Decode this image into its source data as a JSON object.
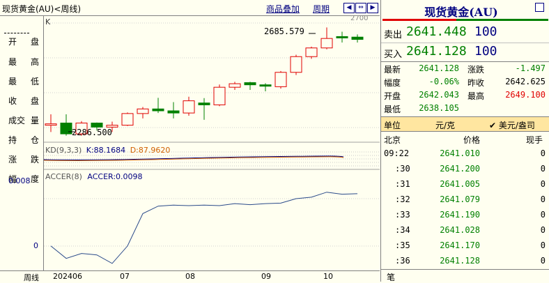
{
  "header": {
    "title": "现货黄金(AU)<周线)",
    "link_overlay": "商品叠加",
    "link_period": "周期"
  },
  "left_labels": [
    {
      "a": "开",
      "b": "盘"
    },
    {
      "a": "最",
      "b": "高"
    },
    {
      "a": "最",
      "b": "低"
    },
    {
      "a": "收",
      "b": "盘"
    },
    {
      "a": "成交",
      "b": "量"
    },
    {
      "a": "持",
      "b": "仓"
    },
    {
      "a": "涨",
      "b": "跌"
    },
    {
      "a": "幅",
      "b": "度"
    }
  ],
  "chart": {
    "k_label": "K",
    "top_axis_label": "2700",
    "high_annotation": "2685.579",
    "low_annotation": "2286.500",
    "kd_label": "KD(9,3,3)",
    "kd_k": "K:88.1684",
    "kd_d": "D:87.9620",
    "accer_label": "ACCER(8)",
    "accer_value": "ACCER:0.0098",
    "accer_tick_high": "0.008",
    "accer_tick_zero": "0",
    "x_labels": [
      "202406",
      "07",
      "08",
      "09",
      "10"
    ],
    "period_label": "周线"
  },
  "chart_data": {
    "type": "candlestick",
    "candles": [
      {
        "o": 2330,
        "h": 2365,
        "l": 2300,
        "c": 2330
      },
      {
        "o": 2333,
        "h": 2365,
        "l": 2286.5,
        "c": 2293
      },
      {
        "o": 2293,
        "h": 2340,
        "l": 2286.5,
        "c": 2333
      },
      {
        "o": 2333,
        "h": 2335,
        "l": 2305,
        "c": 2318
      },
      {
        "o": 2318,
        "h": 2338,
        "l": 2300,
        "c": 2325
      },
      {
        "o": 2325,
        "h": 2372,
        "l": 2322,
        "c": 2368
      },
      {
        "o": 2368,
        "h": 2392,
        "l": 2350,
        "c": 2385
      },
      {
        "o": 2385,
        "h": 2426,
        "l": 2370,
        "c": 2378
      },
      {
        "o": 2378,
        "h": 2410,
        "l": 2350,
        "c": 2370
      },
      {
        "o": 2370,
        "h": 2430,
        "l": 2360,
        "c": 2415
      },
      {
        "o": 2407,
        "h": 2425,
        "l": 2345,
        "c": 2400
      },
      {
        "o": 2400,
        "h": 2475,
        "l": 2395,
        "c": 2465
      },
      {
        "o": 2465,
        "h": 2485,
        "l": 2455,
        "c": 2478
      },
      {
        "o": 2482,
        "h": 2485,
        "l": 2455,
        "c": 2474
      },
      {
        "o": 2474,
        "h": 2480,
        "l": 2450,
        "c": 2470
      },
      {
        "o": 2467,
        "h": 2525,
        "l": 2460,
        "c": 2520
      },
      {
        "o": 2520,
        "h": 2585,
        "l": 2510,
        "c": 2578
      },
      {
        "o": 2578,
        "h": 2615,
        "l": 2570,
        "c": 2610
      },
      {
        "o": 2610,
        "h": 2685.579,
        "l": 2605,
        "c": 2645
      },
      {
        "o": 2652,
        "h": 2670,
        "l": 2630,
        "c": 2650
      },
      {
        "o": 2650,
        "h": 2660,
        "l": 2630,
        "c": 2641.448
      }
    ],
    "ylim": [
      2270,
      2720
    ],
    "accer": [
      -0.001,
      -0.0035,
      -0.0025,
      -0.0028,
      -0.0045,
      -0.001,
      0.0055,
      0.007,
      0.0072,
      0.0071,
      0.0072,
      0.0071,
      0.0075,
      0.0073,
      0.0075,
      0.0076,
      0.0085,
      0.0088,
      0.0098,
      0.0094,
      0.0095
    ],
    "accer_ylim": [
      -0.0055,
      0.012
    ],
    "colors": {
      "up": "#e00000",
      "down": "#008000",
      "line": "#2a4a8a"
    }
  },
  "quote": {
    "title": "现货黄金(AU)",
    "sell_label": "卖出",
    "sell_price": "2641.448",
    "sell_qty": "100",
    "buy_label": "买入",
    "buy_price": "2641.128",
    "buy_qty": "100",
    "stats": [
      {
        "l1": "最新",
        "v1": "2641.128",
        "c1": "green",
        "l2": "涨跌",
        "v2": "-1.497",
        "c2": "green"
      },
      {
        "l1": "幅度",
        "v1": "-0.06%",
        "c1": "green",
        "l2": "昨收",
        "v2": "2642.625",
        "c2": "black"
      },
      {
        "l1": "开盘",
        "v1": "2642.043",
        "c1": "green",
        "l2": "最高",
        "v2": "2649.100",
        "c2": "red"
      },
      {
        "l1": "最低",
        "v1": "2638.105",
        "c1": "green",
        "l2": "",
        "v2": "",
        "c2": "black"
      }
    ],
    "unit_label": "单位",
    "unit_value": "元/克",
    "unit_alt": "✔ 美元/盎司",
    "tick_headers": [
      "北京",
      "价格",
      "现手"
    ],
    "ticks": [
      {
        "time": "09:22",
        "price": "2641.010",
        "qty": "0"
      },
      {
        "time": ":30",
        "price": "2641.200",
        "qty": "0"
      },
      {
        "time": ":31",
        "price": "2641.005",
        "qty": "0"
      },
      {
        "time": ":32",
        "price": "2641.079",
        "qty": "0"
      },
      {
        "time": ":33",
        "price": "2641.190",
        "qty": "0"
      },
      {
        "time": ":34",
        "price": "2641.028",
        "qty": "0"
      },
      {
        "time": ":35",
        "price": "2641.170",
        "qty": "0"
      },
      {
        "time": ":36",
        "price": "2641.128",
        "qty": "0"
      }
    ],
    "bottom_tab": "笔"
  }
}
